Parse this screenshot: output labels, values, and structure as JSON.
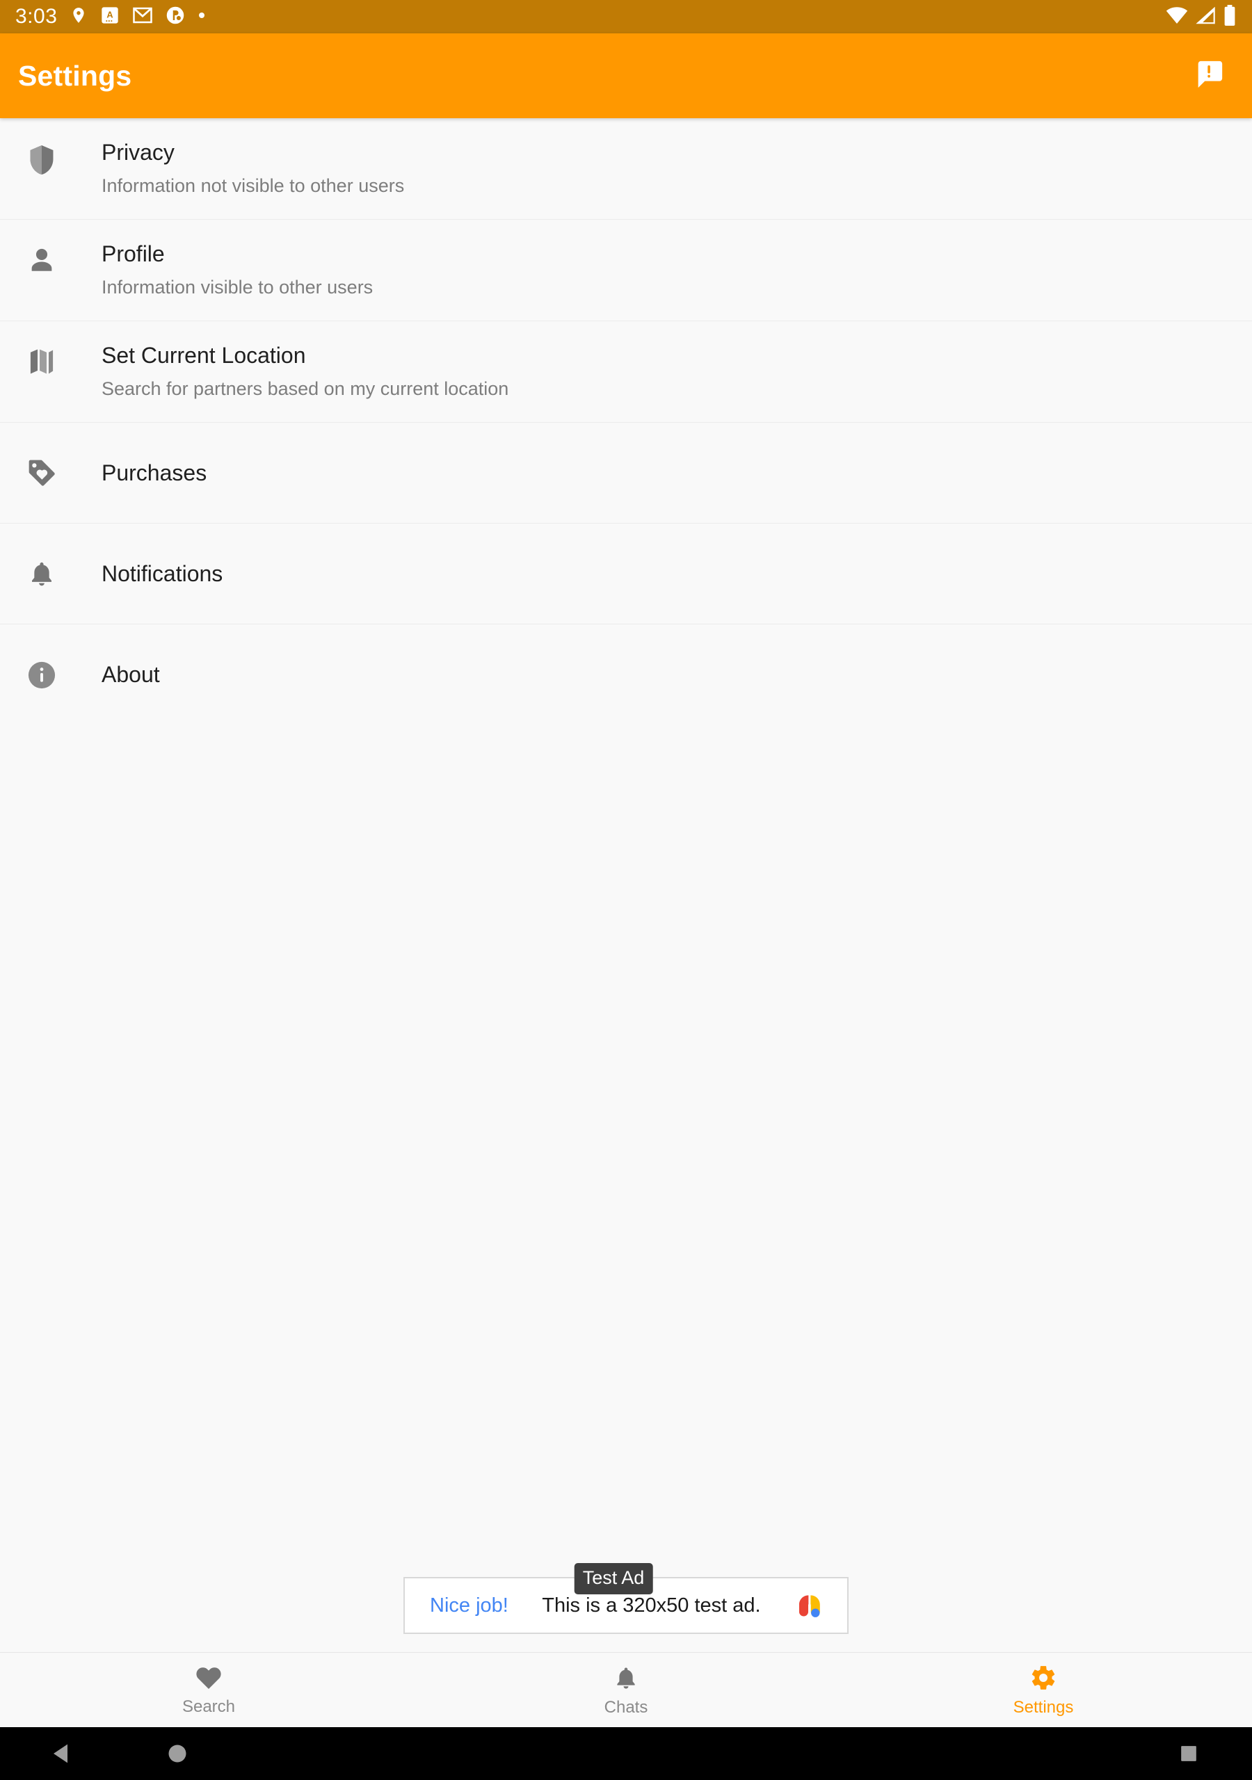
{
  "status_bar": {
    "clock": "3:03",
    "icons": [
      "location-pin-icon",
      "authenticator-icon",
      "gmail-icon",
      "app-circle-icon",
      "dot-icon"
    ],
    "right_icons": [
      "wifi-icon",
      "cellular-signal-icon",
      "battery-icon"
    ],
    "background_color": "#c07b05"
  },
  "app_bar": {
    "title": "Settings",
    "action_icon": "feedback-icon",
    "background_color": "#ff9800",
    "text_color": "#ffffff"
  },
  "settings": {
    "items": [
      {
        "icon": "shield-icon",
        "title": "Privacy",
        "subtitle": "Information not visible to other users"
      },
      {
        "icon": "person-icon",
        "title": "Profile",
        "subtitle": "Information visible to other users"
      },
      {
        "icon": "map-icon",
        "title": "Set Current Location",
        "subtitle": "Search for partners based on my current location"
      },
      {
        "icon": "tag-icon",
        "title": "Purchases",
        "subtitle": ""
      },
      {
        "icon": "bell-icon",
        "title": "Notifications",
        "subtitle": ""
      },
      {
        "icon": "info-icon",
        "title": "About",
        "subtitle": ""
      }
    ]
  },
  "ad": {
    "badge": "Test Ad",
    "cta": "Nice job!",
    "body": "This is a 320x50 test ad.",
    "logo": "admob-logo-icon",
    "cta_color": "#4285f4"
  },
  "bottom_nav": {
    "items": [
      {
        "icon": "heart-icon",
        "label": "Search",
        "active": false
      },
      {
        "icon": "bell-icon",
        "label": "Chats",
        "active": false
      },
      {
        "icon": "gear-icon",
        "label": "Settings",
        "active": true
      }
    ],
    "active_color": "#ff9800",
    "inactive_color": "#8a8a8a"
  },
  "system_nav": {
    "back": "back-triangle-icon",
    "home": "home-circle-icon",
    "recents": "recents-square-icon"
  }
}
